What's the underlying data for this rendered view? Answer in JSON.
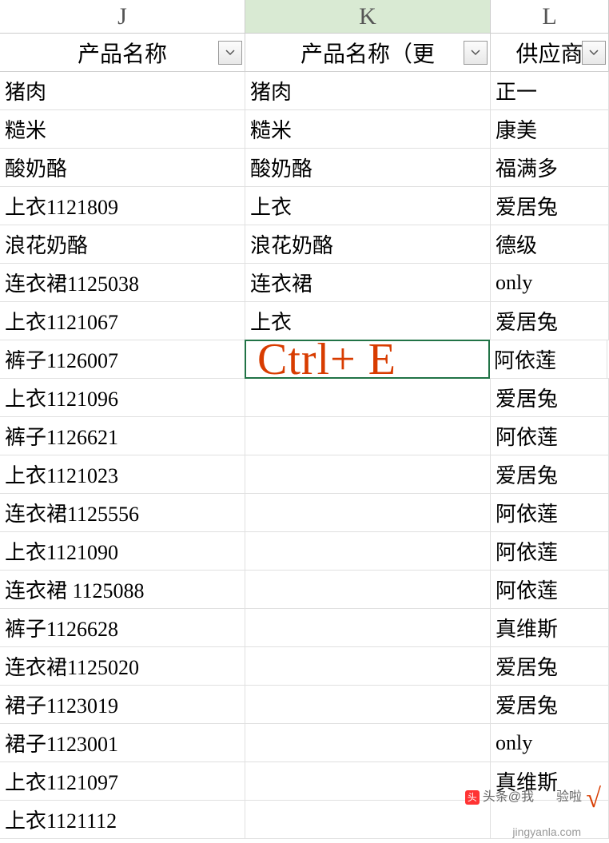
{
  "columns": {
    "j": "J",
    "k": "K",
    "l": "L"
  },
  "headers": {
    "j": "产品名称",
    "k": "产品名称（更",
    "l": "供应商"
  },
  "rows": [
    {
      "j": "猪肉",
      "k": "猪肉",
      "l": "正一"
    },
    {
      "j": "糙米",
      "k": "糙米",
      "l": "康美"
    },
    {
      "j": "酸奶酪",
      "k": "酸奶酪",
      "l": "福满多"
    },
    {
      "j": "上衣1121809",
      "k": "上衣",
      "l": "爱居兔"
    },
    {
      "j": "浪花奶酪",
      "k": "浪花奶酪",
      "l": "德级"
    },
    {
      "j": "连衣裙1125038",
      "k": "连衣裙",
      "l": "only"
    },
    {
      "j": "上衣1121067",
      "k": "上衣",
      "l": "爱居兔"
    },
    {
      "j": "裤子1126007",
      "k": "",
      "l": "阿依莲"
    },
    {
      "j": "上衣1121096",
      "k": "",
      "l": "爱居兔"
    },
    {
      "j": "裤子1126621",
      "k": "",
      "l": "阿依莲"
    },
    {
      "j": "上衣1121023",
      "k": "",
      "l": "爱居兔"
    },
    {
      "j": "连衣裙1125556",
      "k": "",
      "l": "阿依莲"
    },
    {
      "j": "上衣1121090",
      "k": "",
      "l": "阿依莲"
    },
    {
      "j": "连衣裙 1125088",
      "k": "",
      "l": "阿依莲"
    },
    {
      "j": "裤子1126628",
      "k": "",
      "l": "真维斯"
    },
    {
      "j": "连衣裙1125020",
      "k": "",
      "l": "爱居兔"
    },
    {
      "j": "裙子1123019",
      "k": "",
      "l": "爱居兔"
    },
    {
      "j": "裙子1123001",
      "k": "",
      "l": "only"
    },
    {
      "j": "上衣1121097",
      "k": "",
      "l": "真维斯"
    },
    {
      "j": "上衣1121112",
      "k": "",
      "l": ""
    }
  ],
  "overlay": "Ctrl+ E",
  "watermarks": {
    "toutiao": "头条@我",
    "toutiao_suffix": "验啦",
    "jingyanla": "jingyanla.com"
  },
  "checkmark": "√",
  "active_cell_row_index": 7
}
